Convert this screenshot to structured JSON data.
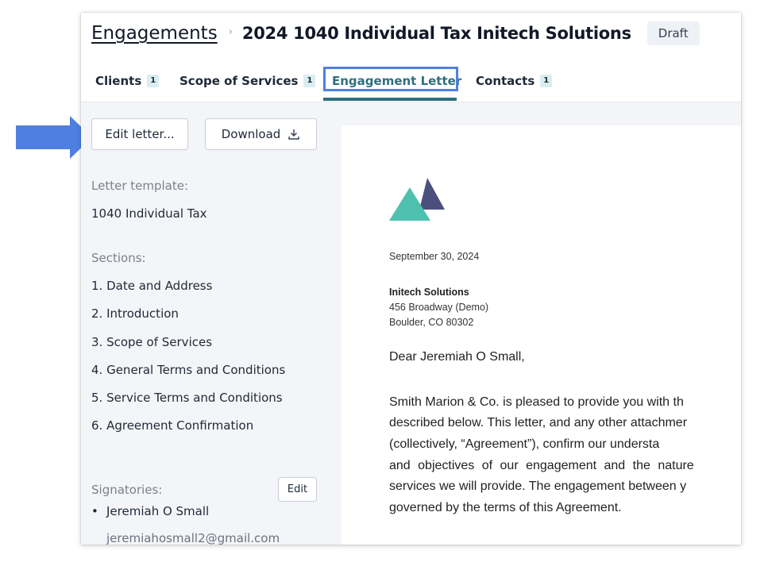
{
  "breadcrumb": {
    "parent": "Engagements",
    "title": "2024 1040 Individual Tax Initech Solutions",
    "status": "Draft"
  },
  "tabs": [
    {
      "label": "Clients",
      "count": "1"
    },
    {
      "label": "Scope of Services",
      "count": "1"
    },
    {
      "label": "Engagement Letter",
      "count": ""
    },
    {
      "label": "Contacts",
      "count": "1"
    }
  ],
  "toolbar": {
    "edit_label": "Edit letter...",
    "download_label": "Download"
  },
  "sidebar": {
    "template_label": "Letter template:",
    "template_value": "1040 Individual Tax",
    "sections_label": "Sections:",
    "sections": [
      "1. Date and Address",
      "2. Introduction",
      "3. Scope of Services",
      "4. General Terms and Conditions",
      "5. Service Terms and Conditions",
      "6. Agreement Confirmation"
    ],
    "signatories_label": "Signatories:",
    "signatories_edit": "Edit",
    "signatory_name": "Jeremiah O Small",
    "signatory_email": "jeremiahosmall2@gmail.com"
  },
  "letter": {
    "date": "September 30, 2024",
    "company": "Initech Solutions",
    "address1": "456 Broadway (Demo)",
    "address2": "Boulder, CO 80302",
    "salutation": "Dear Jeremiah O Small,",
    "body_lines": [
      "Smith Marion & Co. is pleased to provide you with th",
      "described below. This letter, and any other attachmer",
      "(collectively,  “Agreement”),  confirm  our  understa",
      "and objectives of our engagement and the nature",
      "services we will provide. The engagement between y",
      "governed by the terms of this Agreement."
    ]
  },
  "colors": {
    "accent_blue": "#4f7fe0",
    "tab_underline": "#2f6f7f",
    "logo_teal": "#4fc0b0",
    "logo_navy": "#4a4f7e"
  },
  "icons": {
    "download": "download-icon",
    "pointer": "arrow-right-icon",
    "logo": "firm-logo-icon"
  }
}
